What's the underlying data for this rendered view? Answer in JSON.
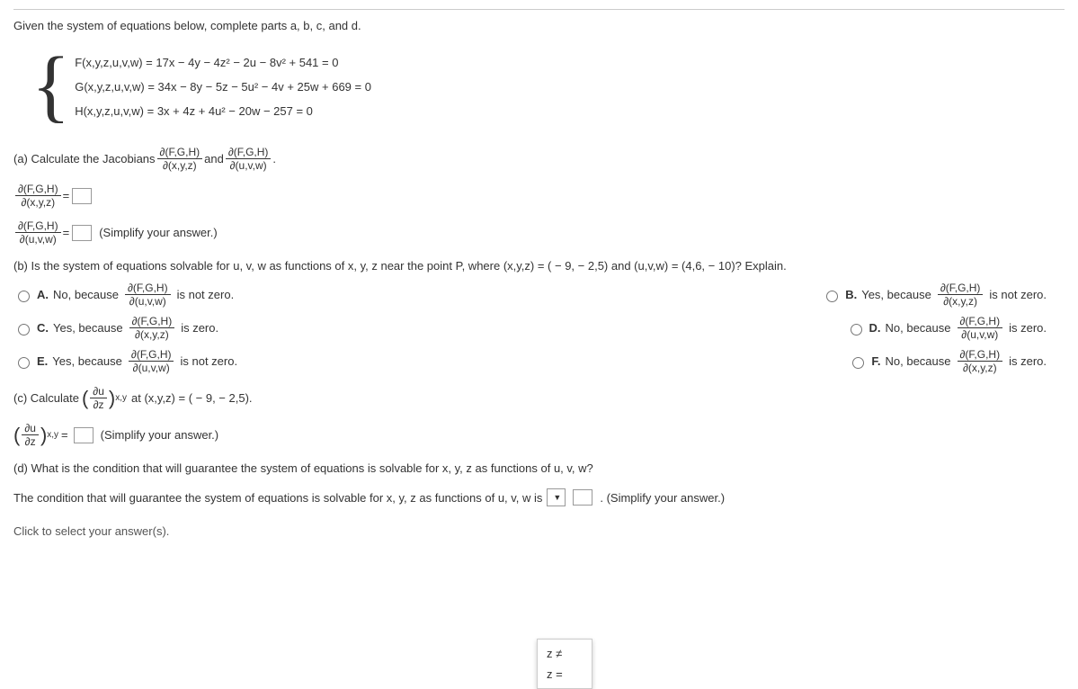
{
  "intro": "Given the system of equations below, complete parts a, b, c, and d.",
  "equations": {
    "f": "F(x,y,z,u,v,w) = 17x − 4y − 4z² − 2u − 8v² + 541 = 0",
    "g": "G(x,y,z,u,v,w) = 34x − 8y − 5z − 5u² − 4v + 25w + 669 = 0",
    "h": "H(x,y,z,u,v,w) = 3x + 4z + 4u² − 20w − 257 = 0"
  },
  "partA": {
    "text1": "(a) Calculate the Jacobians",
    "frac1num": "∂(F,G,H)",
    "frac1den": "∂(x,y,z)",
    "and": "and",
    "frac2num": "∂(F,G,H)",
    "frac2den": "∂(u,v,w)",
    "period": "."
  },
  "answerA1": {
    "fracnum": "∂(F,G,H)",
    "fracden": "∂(x,y,z)",
    "equals": "="
  },
  "answerA2": {
    "fracnum": "∂(F,G,H)",
    "fracden": "∂(u,v,w)",
    "equals": "=",
    "simplify": "(Simplify your answer.)"
  },
  "partB": {
    "text": "(b) Is the system of equations solvable for u, v, w as functions of x, y, z near the point P, where (x,y,z) = ( − 9, − 2,5) and (u,v,w) = (4,6, − 10)? Explain."
  },
  "options": {
    "A": {
      "label": "A.",
      "pre": "No, because",
      "num": "∂(F,G,H)",
      "den": "∂(u,v,w)",
      "post": "is not zero."
    },
    "B": {
      "label": "B.",
      "pre": "Yes, because",
      "num": "∂(F,G,H)",
      "den": "∂(x,y,z)",
      "post": "is not zero."
    },
    "C": {
      "label": "C.",
      "pre": "Yes, because",
      "num": "∂(F,G,H)",
      "den": "∂(x,y,z)",
      "post": "is zero."
    },
    "D": {
      "label": "D.",
      "pre": "No, because",
      "num": "∂(F,G,H)",
      "den": "∂(u,v,w)",
      "post": "is zero."
    },
    "E": {
      "label": "E.",
      "pre": "Yes, because",
      "num": "∂(F,G,H)",
      "den": "∂(u,v,w)",
      "post": "is not zero."
    },
    "F": {
      "label": "F.",
      "pre": "No, because",
      "num": "∂(F,G,H)",
      "den": "∂(x,y,z)",
      "post": "is zero."
    }
  },
  "partC": {
    "pre": "(c) Calculate",
    "num": "∂u",
    "den": "∂z",
    "sub": "x,y",
    "post": "at (x,y,z) = ( − 9, − 2,5)."
  },
  "answerC": {
    "num": "∂u",
    "den": "∂z",
    "sub": "x,y",
    "equals": "=",
    "simplify": "(Simplify your answer.)"
  },
  "partD": {
    "text": "(d) What is the condition that will guarantee the system of equations is solvable for x, y, z as functions of u, v, w?",
    "line2pre": "The condition that will guarantee the system of equations is solvable for x, y, z as functions of u, v, w is",
    "line2post": ". (Simplify your answer.)"
  },
  "dropdown": {
    "opt1": "z ≠",
    "opt2": "z ="
  },
  "bottom": "Click to select your answer(s)."
}
